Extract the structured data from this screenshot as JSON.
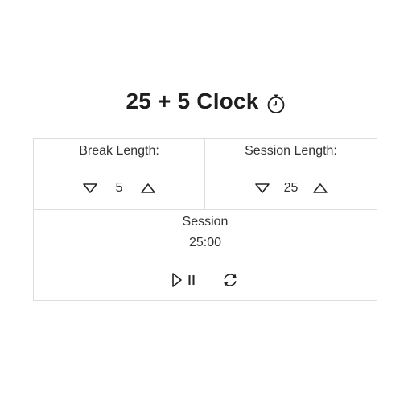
{
  "app": {
    "title": "25 + 5 Clock",
    "title_icon": "stopwatch-icon"
  },
  "break": {
    "label": "Break Length:",
    "value": "5",
    "decrement_icon": "triangle-down-icon",
    "increment_icon": "triangle-up-icon"
  },
  "session": {
    "label": "Session Length:",
    "value": "25",
    "decrement_icon": "triangle-down-icon",
    "increment_icon": "triangle-up-icon"
  },
  "timer": {
    "label": "Session",
    "time": "25:00",
    "play_icon": "play-icon",
    "pause_icon": "pause-icon",
    "reset_icon": "refresh-icon"
  },
  "colors": {
    "border": "#dddddd",
    "text": "#222222",
    "background": "#ffffff"
  }
}
